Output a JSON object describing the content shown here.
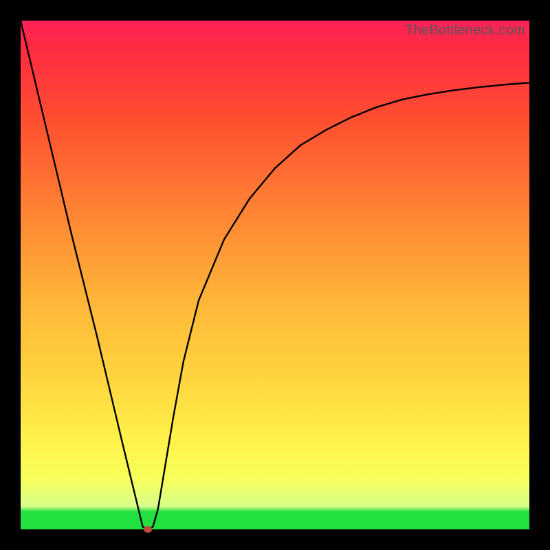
{
  "attribution": "TheBottleneck.com",
  "chart_data": {
    "type": "line",
    "title": "",
    "xlabel": "",
    "ylabel": "",
    "xlim": [
      0,
      100
    ],
    "ylim": [
      0,
      100
    ],
    "series": [
      {
        "name": "bottleneck-curve",
        "x": [
          0,
          5,
          10,
          15,
          20,
          24,
          25,
          26,
          27,
          28,
          30,
          32,
          35,
          40,
          45,
          50,
          55,
          60,
          65,
          70,
          75,
          80,
          85,
          90,
          95,
          100
        ],
        "values": [
          100,
          79,
          58,
          38,
          17,
          0.5,
          0,
          0.5,
          4,
          10,
          22,
          33,
          45,
          57,
          65,
          71,
          75.5,
          78.5,
          81,
          83,
          84.5,
          85.5,
          86.3,
          86.9,
          87.4,
          87.8
        ]
      }
    ],
    "marker": {
      "x": 25,
      "y": 0
    },
    "background": {
      "type": "vertical-gradient",
      "stops": [
        {
          "pos": 0,
          "color": "#22e03f"
        },
        {
          "pos": 4,
          "color": "#d7ff8a"
        },
        {
          "pos": 18,
          "color": "#fff14a"
        },
        {
          "pos": 46,
          "color": "#ffb338"
        },
        {
          "pos": 80,
          "color": "#ff5030"
        },
        {
          "pos": 100,
          "color": "#ff225a"
        }
      ]
    },
    "frame_color": "#000000"
  }
}
